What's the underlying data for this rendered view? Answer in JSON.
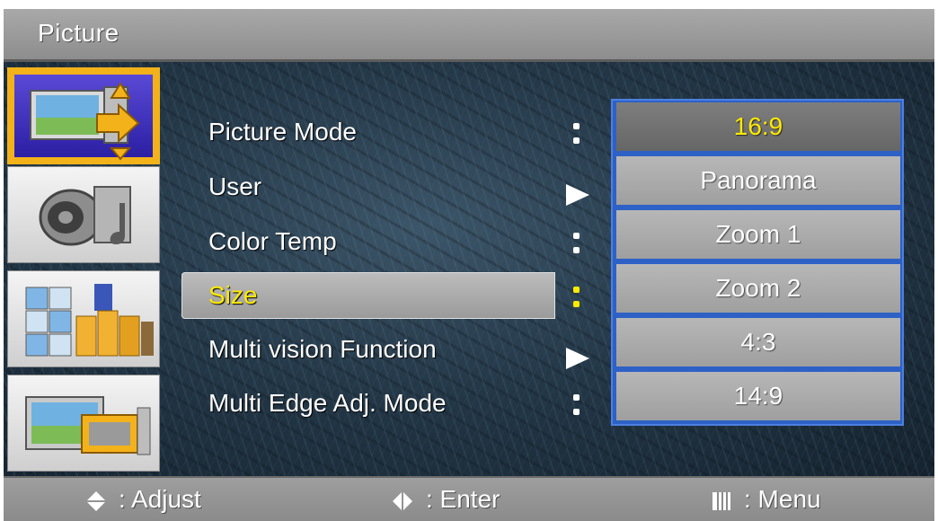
{
  "window": {
    "title": "Picture"
  },
  "icons": [
    "picture-icon",
    "sound-icon",
    "setup-icon",
    "function-icon"
  ],
  "menu": {
    "items": [
      {
        "label": "Picture Mode",
        "marker": "colon"
      },
      {
        "label": "User",
        "marker": "arrow"
      },
      {
        "label": "Color Temp",
        "marker": "colon"
      },
      {
        "label": "Size",
        "marker": "colon",
        "selected": true
      },
      {
        "label": "Multi vision Function",
        "marker": "arrow"
      },
      {
        "label": "Multi Edge Adj. Mode",
        "marker": "colon"
      }
    ]
  },
  "size_options": {
    "selected": "16:9",
    "items": [
      "16:9",
      "Panorama",
      "Zoom 1",
      "Zoom 2",
      "4:3",
      "14:9"
    ]
  },
  "footer": {
    "adjust": ": Adjust",
    "enter": ":  Enter",
    "menu": ":  Menu"
  },
  "colors": {
    "selected_text": "#ffea00",
    "options_border": "#2e61c6",
    "active_tab": "#f3b21a"
  }
}
